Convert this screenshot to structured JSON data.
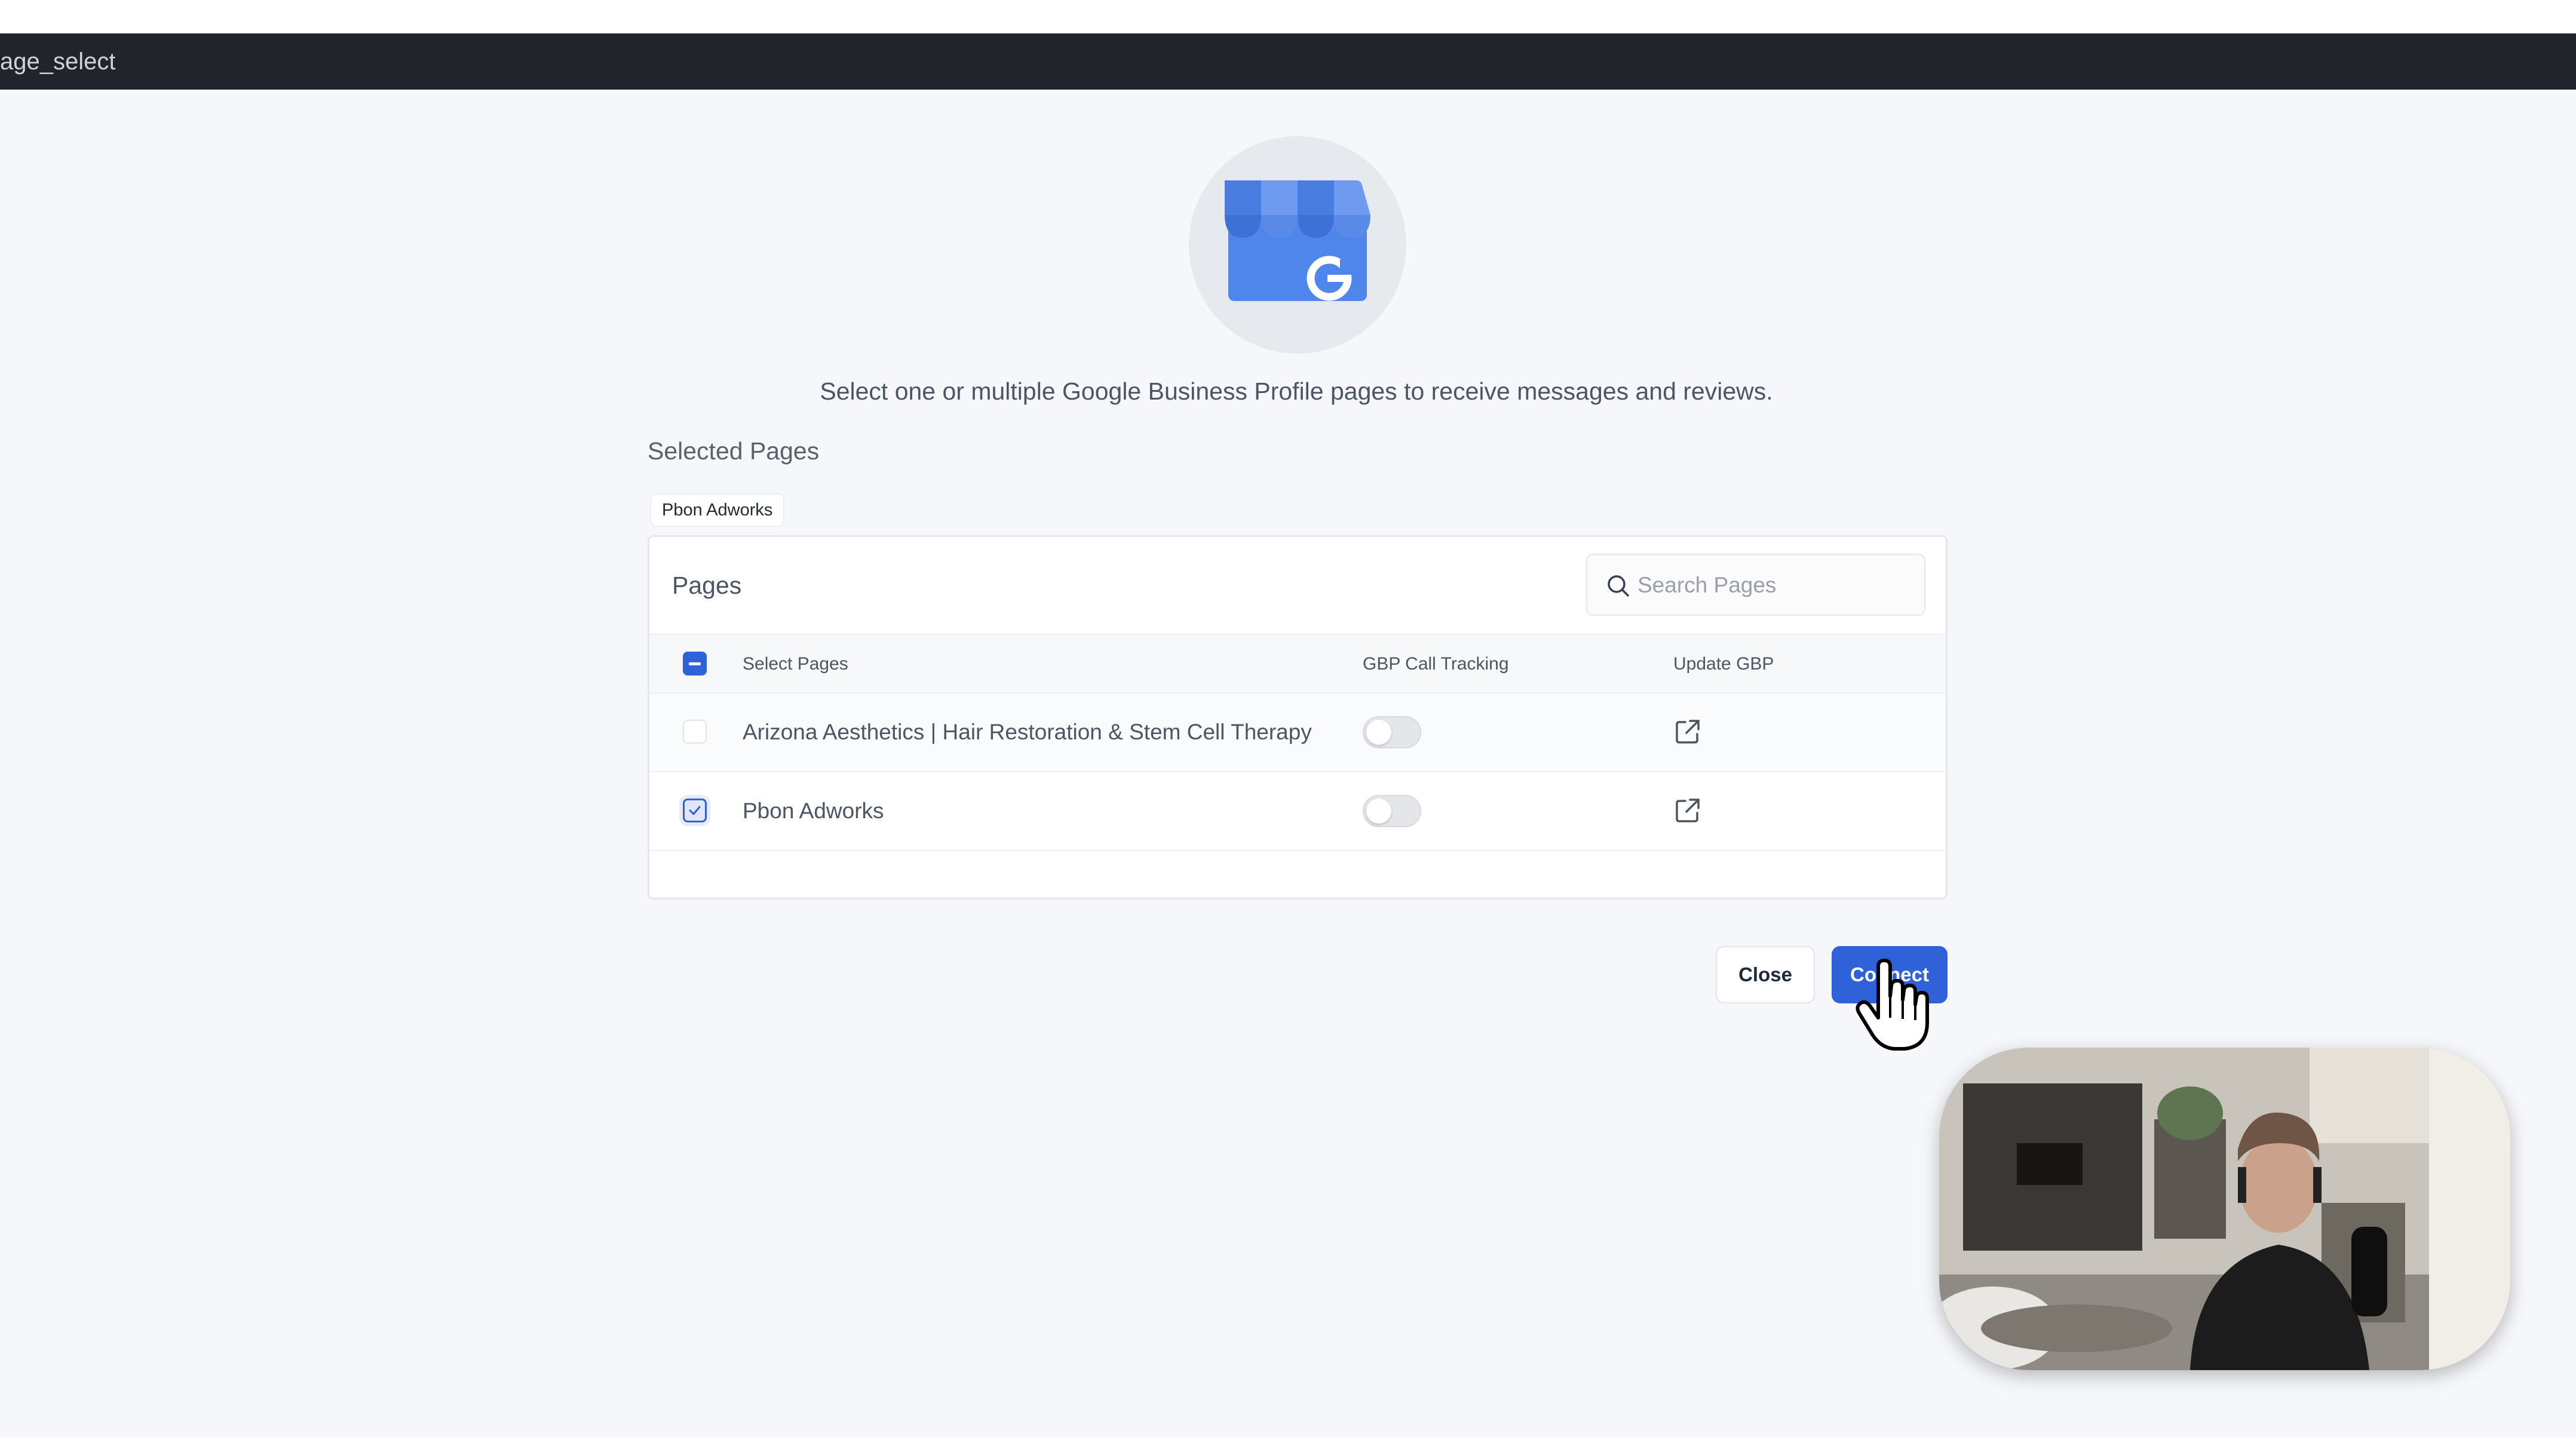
{
  "window": {
    "title": "age_select"
  },
  "header": {
    "subtitle": "Select one or multiple Google Business Profile pages to receive messages and reviews."
  },
  "selected": {
    "label": "Selected Pages",
    "chips": [
      "Pbon Adworks"
    ]
  },
  "pages": {
    "title": "Pages",
    "search": {
      "placeholder": "Search Pages",
      "value": ""
    },
    "columns": [
      "Select Pages",
      "GBP Call Tracking",
      "Update GBP"
    ],
    "rows": [
      {
        "name": "Arizona Aesthetics | Hair Restoration & Stem Cell Therapy",
        "selected": false,
        "call_tracking": false
      },
      {
        "name": "Pbon Adworks",
        "selected": true,
        "call_tracking": false
      }
    ]
  },
  "actions": {
    "close_label": "Close",
    "connect_label": "Connect"
  },
  "colors": {
    "accent": "#2f62d8",
    "titlebar": "#21242a",
    "background": "#f5f7fa"
  },
  "icons": {
    "logo": "google-my-business-icon",
    "search": "search-icon",
    "external": "external-link-icon",
    "cursor": "hand-cursor-icon"
  }
}
